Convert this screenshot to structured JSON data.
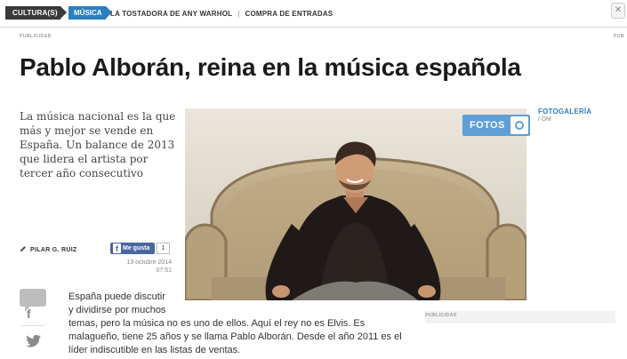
{
  "nav": {
    "crumb_section": "CULTURA(S)",
    "crumb_active": "MÚSICA",
    "link1": "LA TOSTADORA DE ANY WARHOL",
    "separator": "|",
    "link2": "COMPRA DE ENTRADAS"
  },
  "ads": {
    "left_label": "PUBLICIDAD",
    "right_label": "PUB",
    "side_label": "PUBLICIDAD"
  },
  "article": {
    "title": "Pablo Alborán, reina en la música española",
    "lead": "La música nacional es la que más y mejor se vende en España. Un balance de 2013 que lidera el artista por tercer año consecutivo",
    "author": "PILAR G. RUIZ",
    "facebook_label": "Me gusta",
    "facebook_count": "1",
    "date": "13 octubre 2014",
    "time": "07:51",
    "body_lines": [
      "España puede discutir",
      "y dividirse por muchos",
      "temas, pero la música no es uno de ellos. Aquí el rey no es Elvis. Es",
      "malagueño, tiene 25 años y se llama Pablo Alborán. Desde el año 2011 es el",
      "líder indiscutible en las listas de ventas."
    ]
  },
  "gallery": {
    "button_label": "FOTOS",
    "title": "FOTOGALERÍA",
    "credit": "/ DM"
  },
  "share": {
    "facebook_glyph": "f"
  },
  "colors": {
    "accent": "#2b7fbf",
    "fotos_button": "#5f9fd6",
    "facebook": "#4a66a0",
    "nav_dark": "#3a3a3a"
  }
}
